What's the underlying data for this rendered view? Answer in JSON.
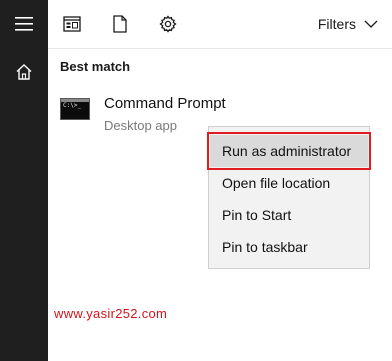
{
  "sidebar": {
    "menu_icon": "hamburger-menu-icon",
    "home_icon": "home-icon"
  },
  "topbar": {
    "icons": [
      "apps-view-icon",
      "documents-icon",
      "settings-icon"
    ],
    "filters_label": "Filters",
    "filters_icon": "chevron-down-icon"
  },
  "best_match": {
    "heading": "Best match",
    "result": {
      "title": "Command Prompt",
      "subtitle": "Desktop app",
      "icon": "command-prompt-icon",
      "icon_glyph": "C:\\>_"
    }
  },
  "context_menu": {
    "items": [
      {
        "label": "Run as administrator",
        "highlighted": true
      },
      {
        "label": "Open file location",
        "highlighted": false
      },
      {
        "label": "Pin to Start",
        "highlighted": false
      },
      {
        "label": "Pin to taskbar",
        "highlighted": false
      }
    ]
  },
  "watermark": "www.yasir252.com",
  "colors": {
    "sidebar": "#1f1f1f",
    "highlight_border": "#e11b22",
    "watermark": "#d4141c"
  }
}
